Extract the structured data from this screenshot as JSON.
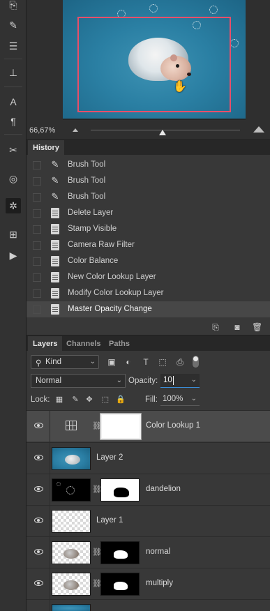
{
  "toolbar": {
    "icons": [
      "brush-icon",
      "sliders-icon",
      "stamp-icon",
      "type-icon",
      "paragraph-icon",
      "tools-icon",
      "target-icon",
      "settings-icon",
      "info-icon",
      "play-icon"
    ]
  },
  "navigator": {
    "zoom": "66,67%"
  },
  "history": {
    "tabs": [
      "History"
    ],
    "items": [
      {
        "label": "Brush Tool",
        "icon": "brush-icon"
      },
      {
        "label": "Brush Tool",
        "icon": "brush-icon"
      },
      {
        "label": "Brush Tool",
        "icon": "brush-icon"
      },
      {
        "label": "Delete Layer",
        "icon": "document-icon"
      },
      {
        "label": "Stamp Visible",
        "icon": "document-icon"
      },
      {
        "label": "Camera Raw Filter",
        "icon": "document-icon"
      },
      {
        "label": "Color Balance",
        "icon": "document-icon"
      },
      {
        "label": "New Color Lookup Layer",
        "icon": "document-icon"
      },
      {
        "label": "Modify Color Lookup Layer",
        "icon": "document-icon"
      },
      {
        "label": "Master Opacity Change",
        "icon": "document-icon",
        "selected": true
      }
    ]
  },
  "layers_panel": {
    "tabs": [
      "Layers",
      "Channels",
      "Paths"
    ],
    "filter_kind": "Kind",
    "blend_mode": "Normal",
    "opacity_label": "Opacity:",
    "opacity_value": "10",
    "lock_label": "Lock:",
    "fill_label": "Fill:",
    "fill_value": "100%",
    "layers": [
      {
        "name": "Color Lookup 1",
        "type": "adjustment",
        "selected": true
      },
      {
        "name": "Layer 2",
        "type": "image"
      },
      {
        "name": "dandelion",
        "type": "masked"
      },
      {
        "name": "Layer 1",
        "type": "transparent"
      },
      {
        "name": "normal",
        "type": "masked"
      },
      {
        "name": "multiply",
        "type": "masked"
      }
    ]
  },
  "colors": {
    "panel_bg": "#383838",
    "selection_bg": "#4b4b4b",
    "nav_red_box": "#e84f6a",
    "focus_blue": "#3b8dd6"
  }
}
